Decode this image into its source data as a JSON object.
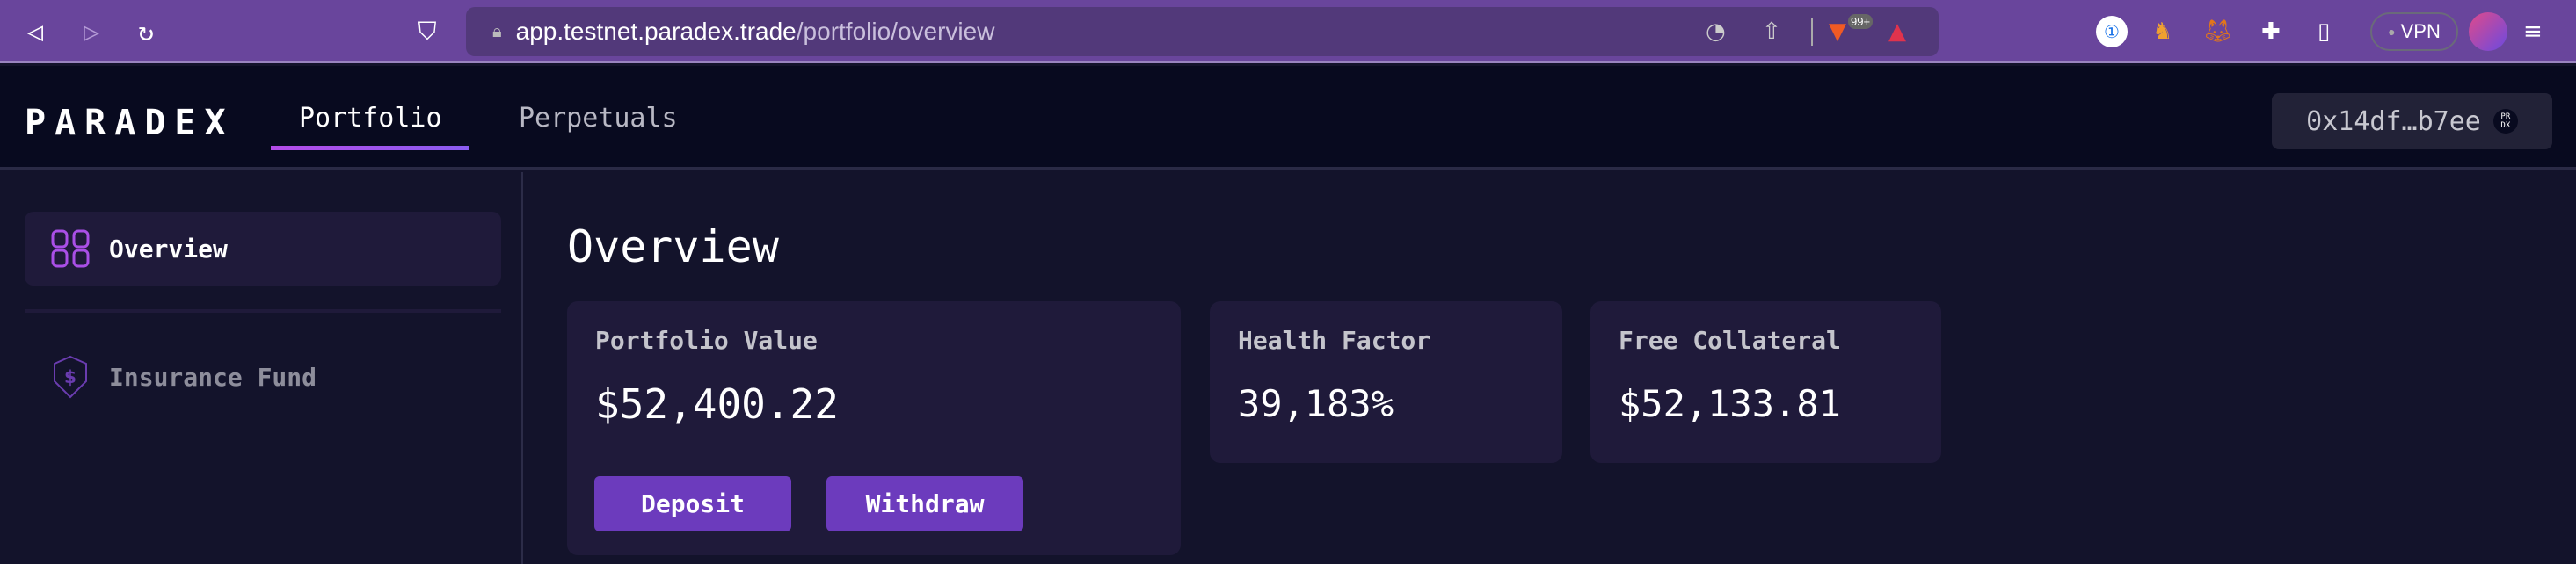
{
  "browser": {
    "url_host": "app.testnet.paradex.trade",
    "url_path": "/portfolio/overview",
    "brave_badge": "99+",
    "vpn_label": "VPN"
  },
  "header": {
    "logo": "PARADEX",
    "tabs": [
      {
        "label": "Portfolio",
        "active": true
      },
      {
        "label": "Perpetuals",
        "active": false
      }
    ],
    "wallet": "0x14df…b7ee",
    "wallet_badge": "PRDX"
  },
  "sidebar": {
    "items": [
      {
        "label": "Overview",
        "active": true
      },
      {
        "label": "Insurance Fund",
        "active": false
      }
    ]
  },
  "main": {
    "title": "Overview",
    "cards": [
      {
        "label": "Portfolio Value",
        "value": "$52,400.22"
      },
      {
        "label": "Health Factor",
        "value": "39,183%"
      },
      {
        "label": "Free Collateral",
        "value": "$52,133.81"
      }
    ],
    "deposit_label": "Deposit",
    "withdraw_label": "Withdraw"
  },
  "colors": {
    "accent": "#6c3bbd",
    "toolbar": "#69459c",
    "background": "#13132b",
    "card": "#1f1a3a"
  }
}
